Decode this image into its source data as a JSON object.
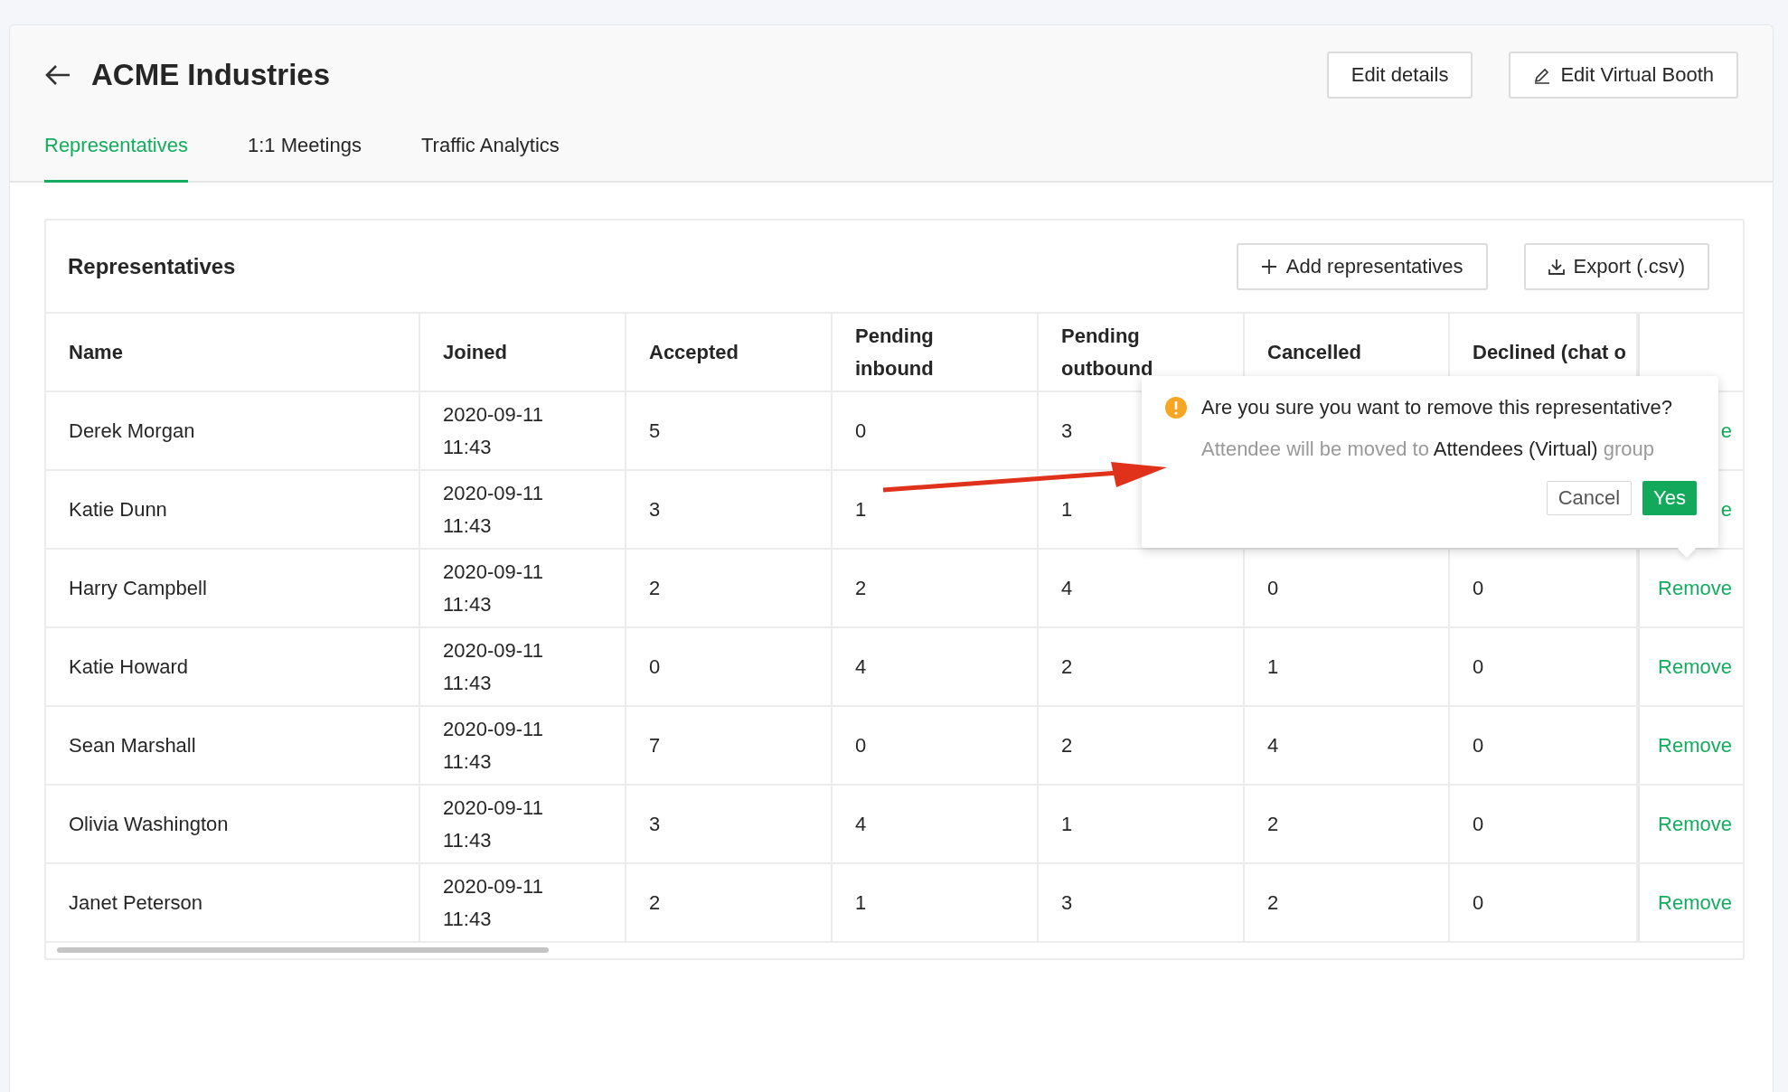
{
  "page": {
    "title": "ACME Industries",
    "buttons": [
      {
        "label": "Edit details",
        "kind": "plain"
      },
      {
        "label": "Edit Virtual Booth",
        "kind": "edit"
      }
    ]
  },
  "tabs": [
    {
      "label": "Representatives",
      "selected": true
    },
    {
      "label": "1:1 Meetings",
      "selected": false
    },
    {
      "label": "Traffic Analytics",
      "selected": false
    }
  ],
  "card": {
    "title": "Representatives",
    "buttons": [
      {
        "label": "Add representatives",
        "kind": "add"
      },
      {
        "label": "Export (.csv)",
        "kind": "export"
      }
    ]
  },
  "table": {
    "columns": [
      "Name",
      "Joined",
      "Accepted",
      "Pending inbound",
      "Pending outbound",
      "Cancelled",
      "Declined (chat o"
    ],
    "rows": [
      {
        "cells": [
          "Derek Morgan",
          "2020-09-11 11:43",
          "5",
          "0",
          "3",
          null,
          null
        ],
        "action": "e"
      },
      {
        "cells": [
          "Katie Dunn",
          "2020-09-11 11:43",
          "3",
          "1",
          "1",
          null,
          null
        ],
        "action": "e"
      },
      {
        "cells": [
          "Harry Campbell",
          "2020-09-11 11:43",
          "2",
          "2",
          "4",
          "0",
          "0"
        ],
        "action": "Remove"
      },
      {
        "cells": [
          "Katie Howard",
          "2020-09-11 11:43",
          "0",
          "4",
          "2",
          "1",
          "0"
        ],
        "action": "Remove"
      },
      {
        "cells": [
          "Sean Marshall",
          "2020-09-11 11:43",
          "7",
          "0",
          "2",
          "4",
          "0"
        ],
        "action": "Remove"
      },
      {
        "cells": [
          "Olivia Washington",
          "2020-09-11 11:43",
          "3",
          "4",
          "1",
          "2",
          "0"
        ],
        "action": "Remove"
      },
      {
        "cells": [
          "Janet Peterson",
          "2020-09-11 11:43",
          "2",
          "1",
          "3",
          "2",
          "0"
        ],
        "action": "Remove"
      }
    ]
  },
  "popconfirm": {
    "question": "Are you sure you want to remove this representative?",
    "note": "Attendee will be moved to **Attendees (Virtual)** group",
    "cancel": "Cancel",
    "confirm": "Yes"
  }
}
